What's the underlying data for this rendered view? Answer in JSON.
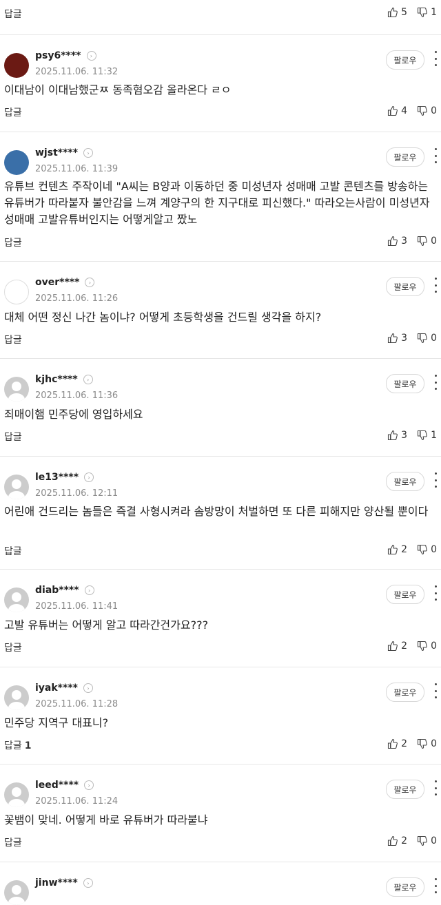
{
  "top": {
    "reply_label": "답글",
    "likes": "5",
    "dislikes": "1"
  },
  "comments": [
    {
      "username": "psy6****",
      "date": "2025.11.06. 11:32",
      "follow": "팔로우",
      "text": "이대남이 이대남했군ㅉ 동족혐오감 올라온다 ㄹㅇ",
      "reply_label": "답글",
      "reply_count": "",
      "likes": "4",
      "dislikes": "0",
      "avatar_color": "#6b1a14"
    },
    {
      "username": "wjst****",
      "date": "2025.11.06. 11:39",
      "follow": "팔로우",
      "text": "유튜브 컨텐츠 주작이네 \"A씨는 B양과 이동하던 중 미성년자 성매매 고발 콘텐츠를 방송하는 유튜버가 따라붙자 불안감을 느껴 계양구의 한 지구대로 피신했다.\" 따라오는사람이 미성년자 성매매 고발유튜버인지는 어떻게알고 짰노",
      "reply_label": "답글",
      "reply_count": "",
      "likes": "3",
      "dislikes": "0",
      "avatar_color": "#3a6fa8"
    },
    {
      "username": "over****",
      "date": "2025.11.06. 11:26",
      "follow": "팔로우",
      "text": "대체 어떤 정신 나간 놈이냐? 어떻게 초등학생을 건드릴 생각을 하지?",
      "reply_label": "답글",
      "reply_count": "",
      "likes": "3",
      "dislikes": "0",
      "avatar_color": "#ffffff"
    },
    {
      "username": "kjhc****",
      "date": "2025.11.06. 11:36",
      "follow": "팔로우",
      "text": "죄매이햄 민주당에 영입하세요",
      "reply_label": "답글",
      "reply_count": "",
      "likes": "3",
      "dislikes": "1",
      "avatar_color": "#cccccc"
    },
    {
      "username": "le13****",
      "date": "2025.11.06. 12:11",
      "follow": "팔로우",
      "text": "어린애 건드리는 놈들은 즉결 사형시켜라 솜방망이 처벌하면 또 다른 피해지만 양산될 뿐이다",
      "reply_label": "답글",
      "reply_count": "",
      "likes": "2",
      "dislikes": "0",
      "avatar_color": "#cccccc"
    },
    {
      "username": "diab****",
      "date": "2025.11.06. 11:41",
      "follow": "팔로우",
      "text": "고발 유튜버는 어떻게 알고 따라간건가요???",
      "reply_label": "답글",
      "reply_count": "",
      "likes": "2",
      "dislikes": "0",
      "avatar_color": "#cccccc"
    },
    {
      "username": "iyak****",
      "date": "2025.11.06. 11:28",
      "follow": "팔로우",
      "text": "민주당 지역구 대표니?",
      "reply_label": "답글",
      "reply_count": "1",
      "likes": "2",
      "dislikes": "0",
      "avatar_color": "#cccccc"
    },
    {
      "username": "leed****",
      "date": "2025.11.06. 11:24",
      "follow": "팔로우",
      "text": "꽃뱀이 맞네. 어떻게 바로 유튜버가 따라붙냐",
      "reply_label": "답글",
      "reply_count": "",
      "likes": "2",
      "dislikes": "0",
      "avatar_color": "#cccccc"
    },
    {
      "username": "jinw****",
      "date": "",
      "follow": "팔로우",
      "text": "",
      "reply_label": "",
      "reply_count": "",
      "likes": "",
      "dislikes": "",
      "avatar_color": "#cccccc"
    }
  ]
}
